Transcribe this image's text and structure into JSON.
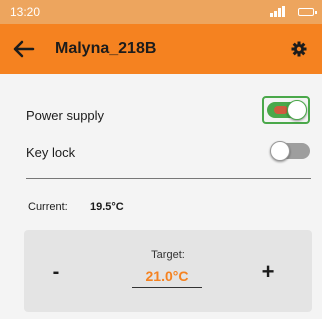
{
  "status_bar": {
    "time": "13:20",
    "signal_icon": "signal-icon",
    "battery_icon": "battery-icon"
  },
  "app_bar": {
    "title": "Malyna_218B",
    "back_icon": "arrow-left-icon",
    "settings_icon": "gear-icon"
  },
  "settings": [
    {
      "label": "Power supply",
      "state": "on"
    },
    {
      "label": "Key lock",
      "state": "off"
    }
  ],
  "temperature": {
    "current_label": "Current:",
    "current_value": "19.5°C",
    "target_label": "Target:",
    "target_value": "21.0°C",
    "decrease_label": "-",
    "increase_label": "+"
  },
  "colors": {
    "accent": "#f58220",
    "status_bar": "#eda55e",
    "toggle_on": "#4aa84a",
    "toggle_off": "#9e9e9e",
    "background": "#f4f4f4",
    "card": "#e4e4e4"
  }
}
